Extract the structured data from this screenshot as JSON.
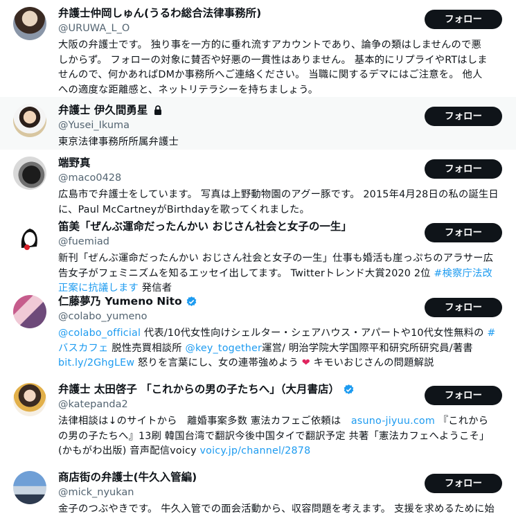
{
  "follow_label": "フォロー",
  "accent_color": "#1d9bf0",
  "accounts": [
    {
      "name": "弁護士仲岡しゅん(うるわ総合法律事務所)",
      "handle": "@URUWA_L_O",
      "bio": "大阪の弁護士です。 独り事を一方的に垂れ流すアカウントであり、論争の類はしませんので悪しからず。 フォローの対象に賛否や好悪の一貫性はありません。 基本的にリプライやRTはしませんので、何かあればDMか事務所へご連絡ください。 当職に関するデマにはご注意を。 他人への適度な距離感と、ネットリテラシーを持ちましょう。"
    },
    {
      "name": "弁護士 伊久間勇星",
      "handle": "@Yusei_Ikuma",
      "bio": "東京法律事務所所属弁護士",
      "icon": "lock-icon"
    },
    {
      "name": "端野真",
      "handle": "@maco0428",
      "bio": "広島市で弁護士をしています。 写真は上野動物園のアグー豚です。 2015年4月28日の私の誕生日に、Paul McCartneyがBirthdayを歌ってくれました。"
    },
    {
      "name": "笛美「ぜんぶ運命だったんかい おじさん社会と女子の一生」",
      "handle": "@fuemiad",
      "bio_parts": [
        "新刊「ぜんぶ運命だったんかい おじさん社会と女子の一生」仕事も婚活も崖っぷちのアラサー広告女子がフェミニズムを知るエッセイ出してます。 Twitterトレンド大賞2020 2位 ",
        "#検察庁法改正案に抗議します",
        " 発信者"
      ]
    },
    {
      "name": "仁藤夢乃 Yumeno Nito",
      "handle": "@colabo_yumeno",
      "icon": "verified-badge-icon",
      "bio_parts": [
        "@colabo_official",
        " 代表/10代女性向けシェルター・シェアハウス・アパートや10代女性無料の ",
        "#バスカフェ",
        " 脱性売買相談所 ",
        "@key_together",
        "運営/ 明治学院大学国際平和研究所研究員/著書",
        "bit.ly/2GhgLEw",
        " 怒りを言葉にし、女の連帯強めよう",
        " キモいおじさんの問題解説"
      ]
    },
    {
      "name": "弁護士 太田啓子 「これからの男の子たちへ」（大月書店）",
      "handle": "@katepanda2",
      "icon": "verified-badge-icon",
      "bio_parts": [
        "法律相談は↓のサイトから　離婚事案多数 憲法カフェご依頼は　",
        "asuno-jiyuu.com",
        " 『これからの男の子たちへ』13刷 韓国台湾で翻訳今後中国タイで翻訳予定 共著「憲法カフェへようこそ」(かもがわ出版) 音声配信voicy ",
        "voicy.jp/channel/2878"
      ]
    },
    {
      "name": "商店街の弁護士(牛久入管編)",
      "handle": "@mick_nyukan",
      "bio": "金子のつぶやきです。 牛久入管での面会活動から、収容問題を考えます。 支援を求めるために始めました。 併せて貧困、LGBTQ、ひとり親、子どもシェ"
    }
  ]
}
